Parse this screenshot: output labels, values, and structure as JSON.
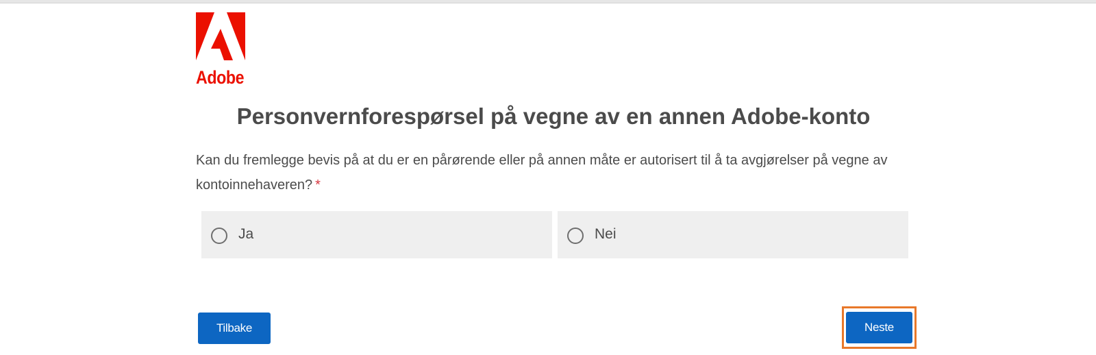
{
  "brand": {
    "name": "Adobe",
    "color": "#eb1000"
  },
  "page": {
    "title": "Personvernforespørsel på vegne av en annen Adobe-konto",
    "question": "Kan du fremlegge bevis på at du er en pårørende eller på annen måte er autorisert til å ta avgjørelser på vegne av kontoinnehaveren?",
    "required_marker": "*"
  },
  "options": [
    {
      "label": "Ja",
      "selected": false
    },
    {
      "label": "Nei",
      "selected": false
    }
  ],
  "buttons": {
    "back_label": "Tilbake",
    "next_label": "Neste"
  },
  "colors": {
    "button_primary": "#0d66c2",
    "highlight_outline": "#e8782a",
    "text": "#4b4b4b",
    "required": "#d7373f",
    "option_bg": "#efefef"
  }
}
